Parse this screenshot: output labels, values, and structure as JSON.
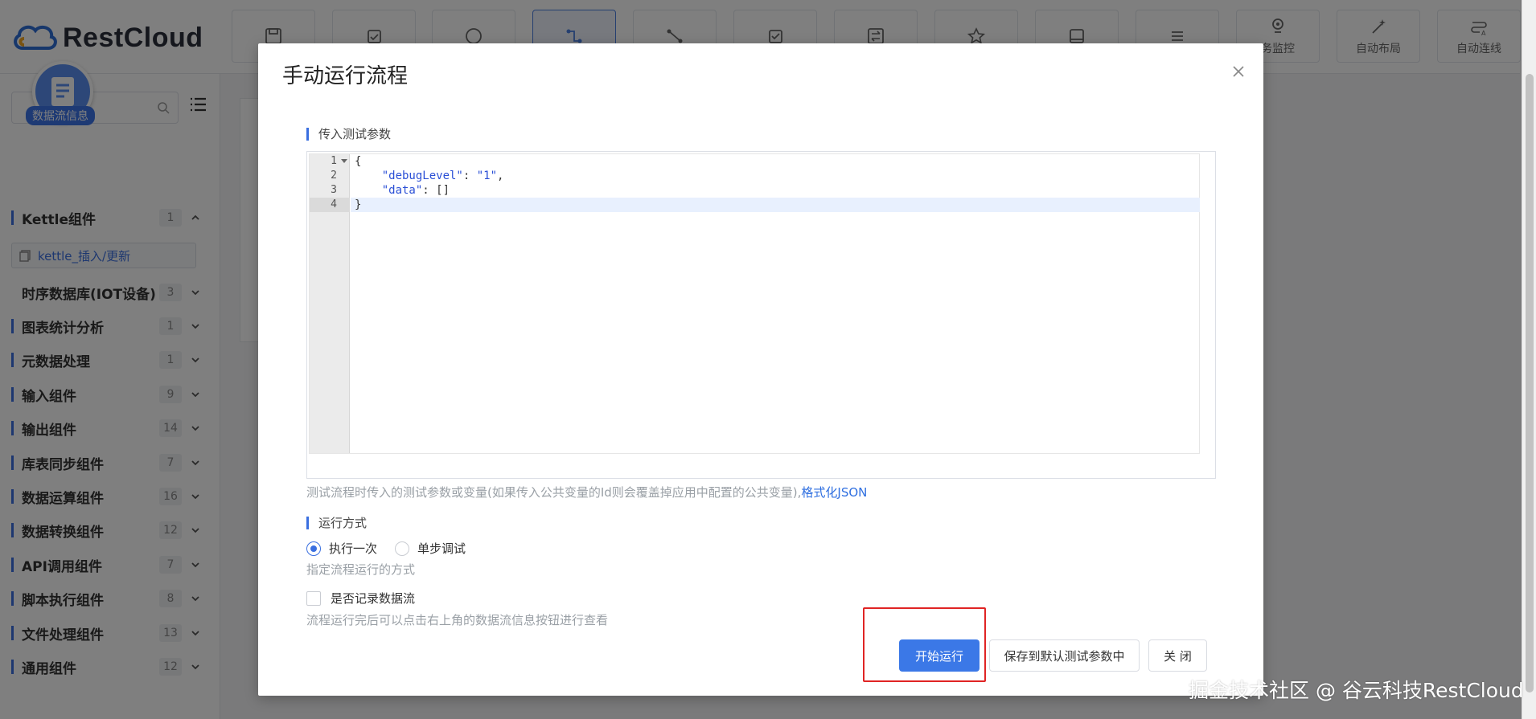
{
  "app": {
    "logo_text": "RestCloud",
    "toolbar_visible_labels": [
      "务监控",
      "自动布局",
      "自动连线"
    ]
  },
  "sidebar": {
    "search_placeholder": "",
    "dataflow_badge": "数据流信息",
    "expanded_item": "kettle_插入/更新",
    "categories": [
      {
        "name": "Kettle组件",
        "count": "1",
        "chevron": "up"
      },
      {
        "name": "时序数据库(IOT设备)",
        "count": "3",
        "chevron": "down"
      },
      {
        "name": "图表统计分析",
        "count": "1",
        "chevron": "down"
      },
      {
        "name": "元数据处理",
        "count": "1",
        "chevron": "down"
      },
      {
        "name": "输入组件",
        "count": "9",
        "chevron": "down"
      },
      {
        "name": "输出组件",
        "count": "14",
        "chevron": "down"
      },
      {
        "name": "库表同步组件",
        "count": "7",
        "chevron": "down"
      },
      {
        "name": "数据运算组件",
        "count": "16",
        "chevron": "down"
      },
      {
        "name": "数据转换组件",
        "count": "12",
        "chevron": "down"
      },
      {
        "name": "API调用组件",
        "count": "7",
        "chevron": "down"
      },
      {
        "name": "脚本执行组件",
        "count": "8",
        "chevron": "down"
      },
      {
        "name": "文件处理组件",
        "count": "13",
        "chevron": "down"
      },
      {
        "name": "通用组件",
        "count": "12",
        "chevron": "down"
      }
    ]
  },
  "modal": {
    "title": "手动运行流程",
    "params_section": "传入测试参数",
    "code_lines": [
      {
        "num": "1",
        "text": "{"
      },
      {
        "num": "2",
        "key": "\"debugLevel\"",
        "sep": ": ",
        "val": "\"1\"",
        "tail": ","
      },
      {
        "num": "3",
        "key": "\"data\"",
        "sep": ": ",
        "val": "[]",
        "tail": ""
      },
      {
        "num": "4",
        "text": "}"
      }
    ],
    "params_hint": "测试流程时传入的测试参数或变量(如果传入公共变量的Id则会覆盖掉应用中配置的公共变量),",
    "format_link": "格式化JSON",
    "run_mode_section": "运行方式",
    "run_once": "执行一次",
    "step_debug": "单步调试",
    "run_mode_hint": "指定流程运行的方式",
    "record_label": "是否记录数据流",
    "record_hint": "流程运行完后可以点击右上角的数据流信息按钮进行查看",
    "btn_start": "开始运行",
    "btn_save": "保存到默认测试参数中",
    "btn_close": "关 闭"
  },
  "watermark": "掘金技术社区 @ 谷云科技RestCloud",
  "colors": {
    "accent": "#3b78e7",
    "highlight_box": "#e02424"
  }
}
